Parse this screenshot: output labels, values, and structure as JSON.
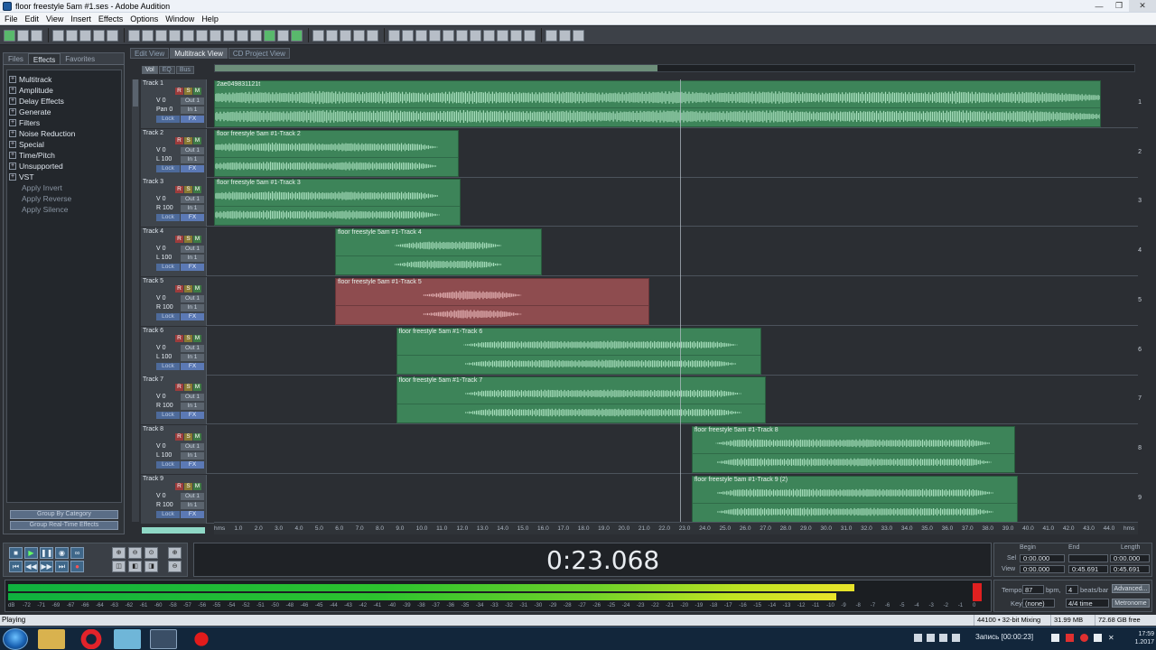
{
  "window": {
    "title": "floor freestyle 5am #1.ses - Adobe Audition"
  },
  "menu": [
    "File",
    "Edit",
    "View",
    "Insert",
    "Effects",
    "Options",
    "Window",
    "Help"
  ],
  "left_tabs": [
    "Files",
    "Effects",
    "Favorites"
  ],
  "effects_tree": [
    {
      "label": "Multitrack",
      "sub": false
    },
    {
      "label": "Amplitude",
      "sub": false
    },
    {
      "label": "Delay Effects",
      "sub": false
    },
    {
      "label": "Generate",
      "sub": false
    },
    {
      "label": "Filters",
      "sub": false
    },
    {
      "label": "Noise Reduction",
      "sub": false
    },
    {
      "label": "Special",
      "sub": false
    },
    {
      "label": "Time/Pitch",
      "sub": false
    },
    {
      "label": "Unsupported",
      "sub": false
    },
    {
      "label": "VST",
      "sub": false
    },
    {
      "label": "Apply Invert",
      "sub": true
    },
    {
      "label": "Apply Reverse",
      "sub": true
    },
    {
      "label": "Apply Silence",
      "sub": true
    }
  ],
  "left_buttons": [
    "Group By Category",
    "Group Real-Time Effects"
  ],
  "view_tabs": [
    "Edit View",
    "Multitrack View",
    "CD Project View"
  ],
  "sub_tabs": [
    "Vol",
    "EQ",
    "Bus"
  ],
  "track_buttons": {
    "r": "R",
    "s": "S",
    "m": "M",
    "lock": "Lock",
    "fx": "FX"
  },
  "tracks": [
    {
      "name": "Track 1",
      "vol": "V 0",
      "pan": "Pan 0",
      "out": "Out 1",
      "in": "In 1",
      "num": "1",
      "clips": [
        {
          "name": "2ae049831121t",
          "color": "green",
          "start": 0.0,
          "end": 0.96,
          "env": [
            0.55,
            0.7,
            0.62,
            0.8,
            0.66,
            0.74,
            0.59,
            0.78,
            0.7,
            0.64,
            0.73,
            0.6,
            0.69,
            0.77,
            0.61,
            0.72,
            0.75,
            0.58,
            0.66,
            0.7,
            0.63,
            0.76,
            0.6,
            0.71,
            0.52,
            0.3
          ]
        }
      ]
    },
    {
      "name": "Track 2",
      "vol": "V 0",
      "pan": "L 100",
      "out": "Out 1",
      "in": "In 1",
      "num": "2",
      "clips": [
        {
          "name": "floor freestyle 5am #1-Track 2",
          "color": "green",
          "start": 0.0,
          "end": 0.265,
          "env": [
            0.35,
            0.5,
            0.42,
            0.55,
            0.45,
            0.5,
            0.4,
            0.52,
            0.48,
            0.44,
            0.5,
            0.4,
            0.0,
            0.0
          ]
        }
      ]
    },
    {
      "name": "Track 3",
      "vol": "V 0",
      "pan": "R 100",
      "out": "Out 1",
      "in": "In 1",
      "num": "3",
      "clips": [
        {
          "name": "floor freestyle 5am #1-Track 3",
          "color": "green",
          "start": 0.0,
          "end": 0.267,
          "env": [
            0.38,
            0.52,
            0.44,
            0.56,
            0.47,
            0.5,
            0.43,
            0.54,
            0.46,
            0.45,
            0.49,
            0.42,
            0.0,
            0.0
          ]
        }
      ]
    },
    {
      "name": "Track 4",
      "vol": "V 0",
      "pan": "L 100",
      "out": "Out 1",
      "in": "In 1",
      "num": "4",
      "clips": [
        {
          "name": "floor freestyle 5am #1-Track 4",
          "color": "green",
          "start": 0.131,
          "end": 0.355,
          "env": [
            0.0,
            0.0,
            0.0,
            0.0,
            0.35,
            0.5,
            0.45,
            0.48,
            0.4,
            0.0,
            0.0,
            0.0
          ]
        }
      ]
    },
    {
      "name": "Track 5",
      "vol": "V 0",
      "pan": "R 100",
      "out": "Out 1",
      "in": "In 1",
      "num": "5",
      "clips": [
        {
          "name": "floor freestyle 5am #1-Track 5",
          "color": "red",
          "start": 0.131,
          "end": 0.471,
          "env": [
            0.0,
            0.0,
            0.0,
            0.0,
            0.0,
            0.3,
            0.55,
            0.48,
            0.4,
            0.0,
            0.0,
            0.0,
            0.0,
            0.0,
            0.0,
            0.0
          ]
        }
      ]
    },
    {
      "name": "Track 6",
      "vol": "V 0",
      "pan": "L 100",
      "out": "Out 1",
      "in": "In 1",
      "num": "6",
      "clips": [
        {
          "name": "floor freestyle 5am #1-Track 6",
          "color": "green",
          "start": 0.197,
          "end": 0.592,
          "env": [
            0.0,
            0.0,
            0.0,
            0.0,
            0.35,
            0.45,
            0.4,
            0.48,
            0.42,
            0.44,
            0.5,
            0.42,
            0.46,
            0.4,
            0.44,
            0.38,
            0.0,
            0.0
          ]
        }
      ]
    },
    {
      "name": "Track 7",
      "vol": "V 0",
      "pan": "R 100",
      "out": "Out 1",
      "in": "In 1",
      "num": "7",
      "clips": [
        {
          "name": "floor freestyle 5am #1-Track 7",
          "color": "green",
          "start": 0.197,
          "end": 0.597,
          "env": [
            0.0,
            0.0,
            0.0,
            0.0,
            0.4,
            0.46,
            0.42,
            0.5,
            0.44,
            0.46,
            0.48,
            0.43,
            0.45,
            0.42,
            0.46,
            0.4,
            0.0,
            0.0
          ]
        }
      ]
    },
    {
      "name": "Track 8",
      "vol": "V 0",
      "pan": "L 100",
      "out": "Out 1",
      "in": "In 1",
      "num": "8",
      "clips": [
        {
          "name": "floor freestyle 5am #1-Track 8",
          "color": "green",
          "start": 0.517,
          "end": 0.867,
          "env": [
            0.0,
            0.0,
            0.45,
            0.5,
            0.42,
            0.48,
            0.46,
            0.44,
            0.5,
            0.42,
            0.47,
            0.45,
            0.43,
            0.48,
            0.0,
            0.0
          ]
        }
      ]
    },
    {
      "name": "Track 9",
      "vol": "V 0",
      "pan": "R 100",
      "out": "Out 1",
      "in": "In 1",
      "num": "9",
      "clips": [
        {
          "name": "floor freestyle 5am #1-Track 9 (2)",
          "color": "green",
          "start": 0.517,
          "end": 0.87,
          "env": [
            0.0,
            0.0,
            0.44,
            0.48,
            0.42,
            0.5,
            0.45,
            0.43,
            0.49,
            0.44,
            0.46,
            0.47,
            0.42,
            0.46,
            0.0,
            0.0
          ]
        }
      ]
    }
  ],
  "timeline_ticks": [
    "hms",
    "1.0",
    "2.0",
    "3.0",
    "4.0",
    "5.0",
    "6.0",
    "7.0",
    "8.0",
    "9.0",
    "10.0",
    "11.0",
    "12.0",
    "13.0",
    "14.0",
    "15.0",
    "16.0",
    "17.0",
    "18.0",
    "19.0",
    "20.0",
    "21.0",
    "22.0",
    "23.0",
    "24.0",
    "25.0",
    "26.0",
    "27.0",
    "28.0",
    "29.0",
    "30.0",
    "31.0",
    "32.0",
    "33.0",
    "34.0",
    "35.0",
    "36.0",
    "37.0",
    "38.0",
    "39.0",
    "40.0",
    "41.0",
    "42.0",
    "43.0",
    "44.0",
    "hms"
  ],
  "cursor_fraction": 0.504,
  "time_display": "0:23.068",
  "selview": {
    "begin_label": "Begin",
    "end_label": "End",
    "length_label": "Length",
    "sel_label": "Sel",
    "view_label": "View",
    "sel_begin": "0:00.000",
    "sel_length": "0:00.000",
    "view_begin": "0:00.000",
    "view_end": "0:45.691",
    "view_length": "0:45.691"
  },
  "meter_level_fraction": 0.88,
  "meter_ticks": [
    "dB",
    "-72",
    "-71",
    "-69",
    "-67",
    "-66",
    "-64",
    "-63",
    "-62",
    "-61",
    "-60",
    "-58",
    "-57",
    "-56",
    "-55",
    "-54",
    "-52",
    "-51",
    "-50",
    "-48",
    "-46",
    "-45",
    "-44",
    "-43",
    "-42",
    "-41",
    "-40",
    "-39",
    "-38",
    "-37",
    "-36",
    "-35",
    "-34",
    "-33",
    "-32",
    "-31",
    "-30",
    "-29",
    "-28",
    "-27",
    "-26",
    "-25",
    "-24",
    "-23",
    "-22",
    "-21",
    "-20",
    "-19",
    "-18",
    "-17",
    "-16",
    "-15",
    "-14",
    "-13",
    "-12",
    "-11",
    "-10",
    "-9",
    "-8",
    "-7",
    "-6",
    "-5",
    "-4",
    "-3",
    "-2",
    "-1",
    "0"
  ],
  "tempo": {
    "tempo_label": "Tempo",
    "tempo_value": "87",
    "bpm_label": "bpm,",
    "beats_value": "4",
    "beats_label": "beats/bar",
    "advanced": "Advanced...",
    "key_label": "Key",
    "key_value": "(none)",
    "time_sig": "4/4 time",
    "metronome": "Metronome"
  },
  "status": {
    "state": "Playing",
    "format": "44100 • 32-bit Mixing",
    "mem": "31.99 MB",
    "free": "72.68 GB free"
  },
  "taskbar": {
    "record_text": "Запись [00:00:23]",
    "time": "17:59",
    "date": "1.2017"
  }
}
